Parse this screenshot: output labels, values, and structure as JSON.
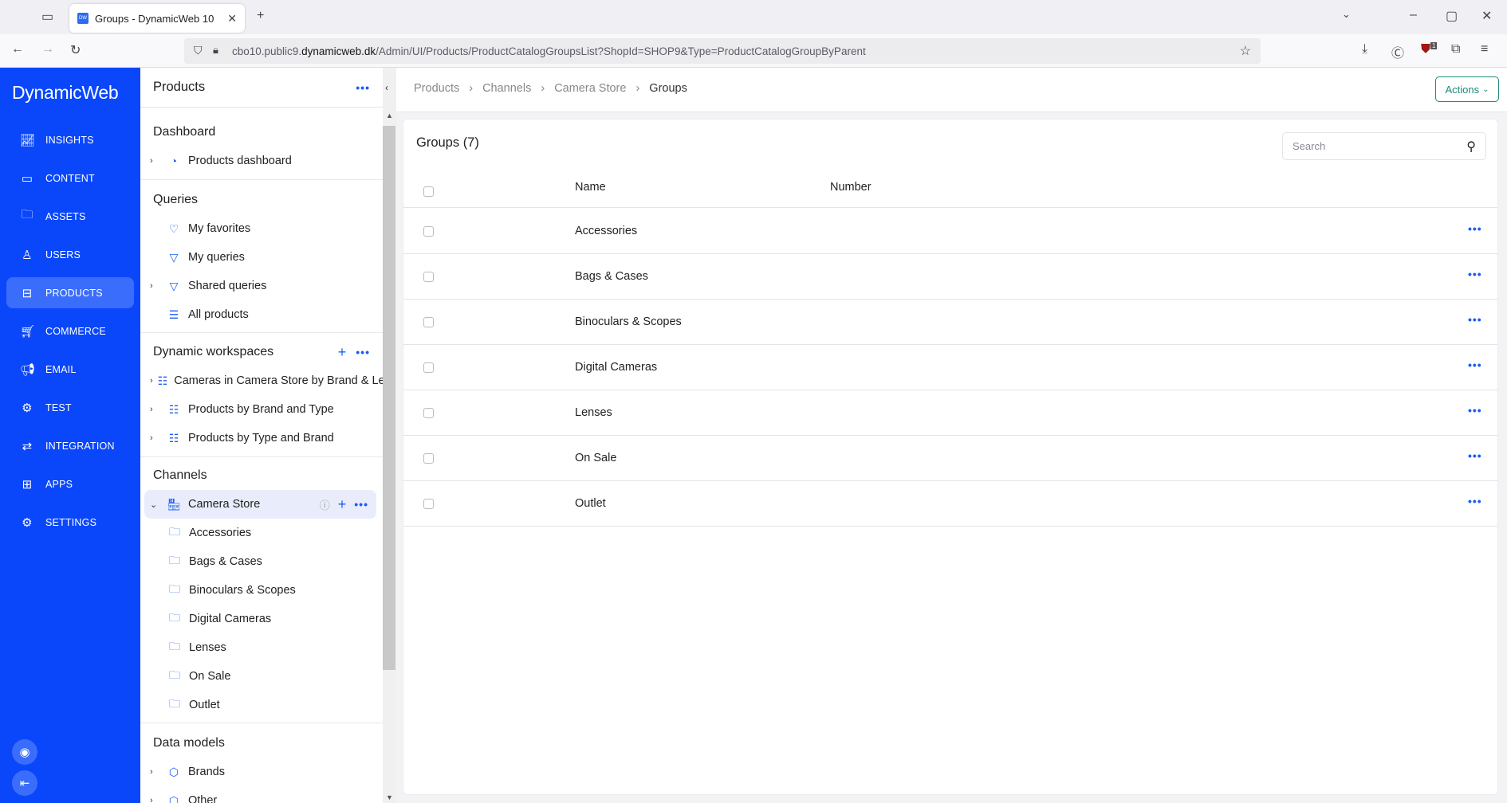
{
  "browser": {
    "tab_title": "Groups - DynamicWeb 10",
    "tab_favicon": "DW",
    "url_prefix": "cbo10.public9.",
    "url_domain": "dynamicweb.dk",
    "url_path": "/Admin/UI/Products/ProductCatalogGroupsList?ShopId=SHOP9&Type=ProductCatalogGroupByParent",
    "extension_badge": "1"
  },
  "brand": {
    "logo": "DynamicWeb",
    "color": "#0a47fa"
  },
  "nav": [
    {
      "label": "INSIGHTS",
      "icon": "chart-line-icon"
    },
    {
      "label": "CONTENT",
      "icon": "monitor-icon"
    },
    {
      "label": "ASSETS",
      "icon": "folder-icon"
    },
    {
      "label": "USERS",
      "icon": "user-icon"
    },
    {
      "label": "PRODUCTS",
      "icon": "archive-icon",
      "active": true
    },
    {
      "label": "COMMERCE",
      "icon": "cart-icon"
    },
    {
      "label": "EMAIL",
      "icon": "megaphone-icon"
    },
    {
      "label": "TEST",
      "icon": "gear-icon"
    },
    {
      "label": "INTEGRATION",
      "icon": "arrows-icon"
    },
    {
      "label": "APPS",
      "icon": "grid-icon"
    },
    {
      "label": "SETTINGS",
      "icon": "gear-icon"
    }
  ],
  "panel": {
    "title": "Products",
    "sections": {
      "dashboard": {
        "title": "Dashboard",
        "items": [
          "Products dashboard"
        ]
      },
      "queries": {
        "title": "Queries",
        "items": [
          "My favorites",
          "My queries",
          "Shared queries",
          "All products"
        ]
      },
      "workspaces": {
        "title": "Dynamic workspaces",
        "items": [
          "Cameras in Camera Store by Brand & Lens",
          "Products by Brand and Type",
          "Products by Type and Brand"
        ]
      },
      "channels": {
        "title": "Channels",
        "store": "Camera Store",
        "items": [
          "Accessories",
          "Bags & Cases",
          "Binoculars & Scopes",
          "Digital Cameras",
          "Lenses",
          "On Sale",
          "Outlet"
        ]
      },
      "datamodels": {
        "title": "Data models",
        "items": [
          "Brands",
          "Other"
        ]
      }
    }
  },
  "breadcrumb": [
    "Products",
    "Channels",
    "Camera Store",
    "Groups"
  ],
  "actions_label": "Actions",
  "list": {
    "title": "Groups (7)",
    "search_placeholder": "Search",
    "columns": [
      "Name",
      "Number"
    ],
    "rows": [
      "Accessories",
      "Bags & Cases",
      "Binoculars & Scopes",
      "Digital Cameras",
      "Lenses",
      "On Sale",
      "Outlet"
    ]
  }
}
